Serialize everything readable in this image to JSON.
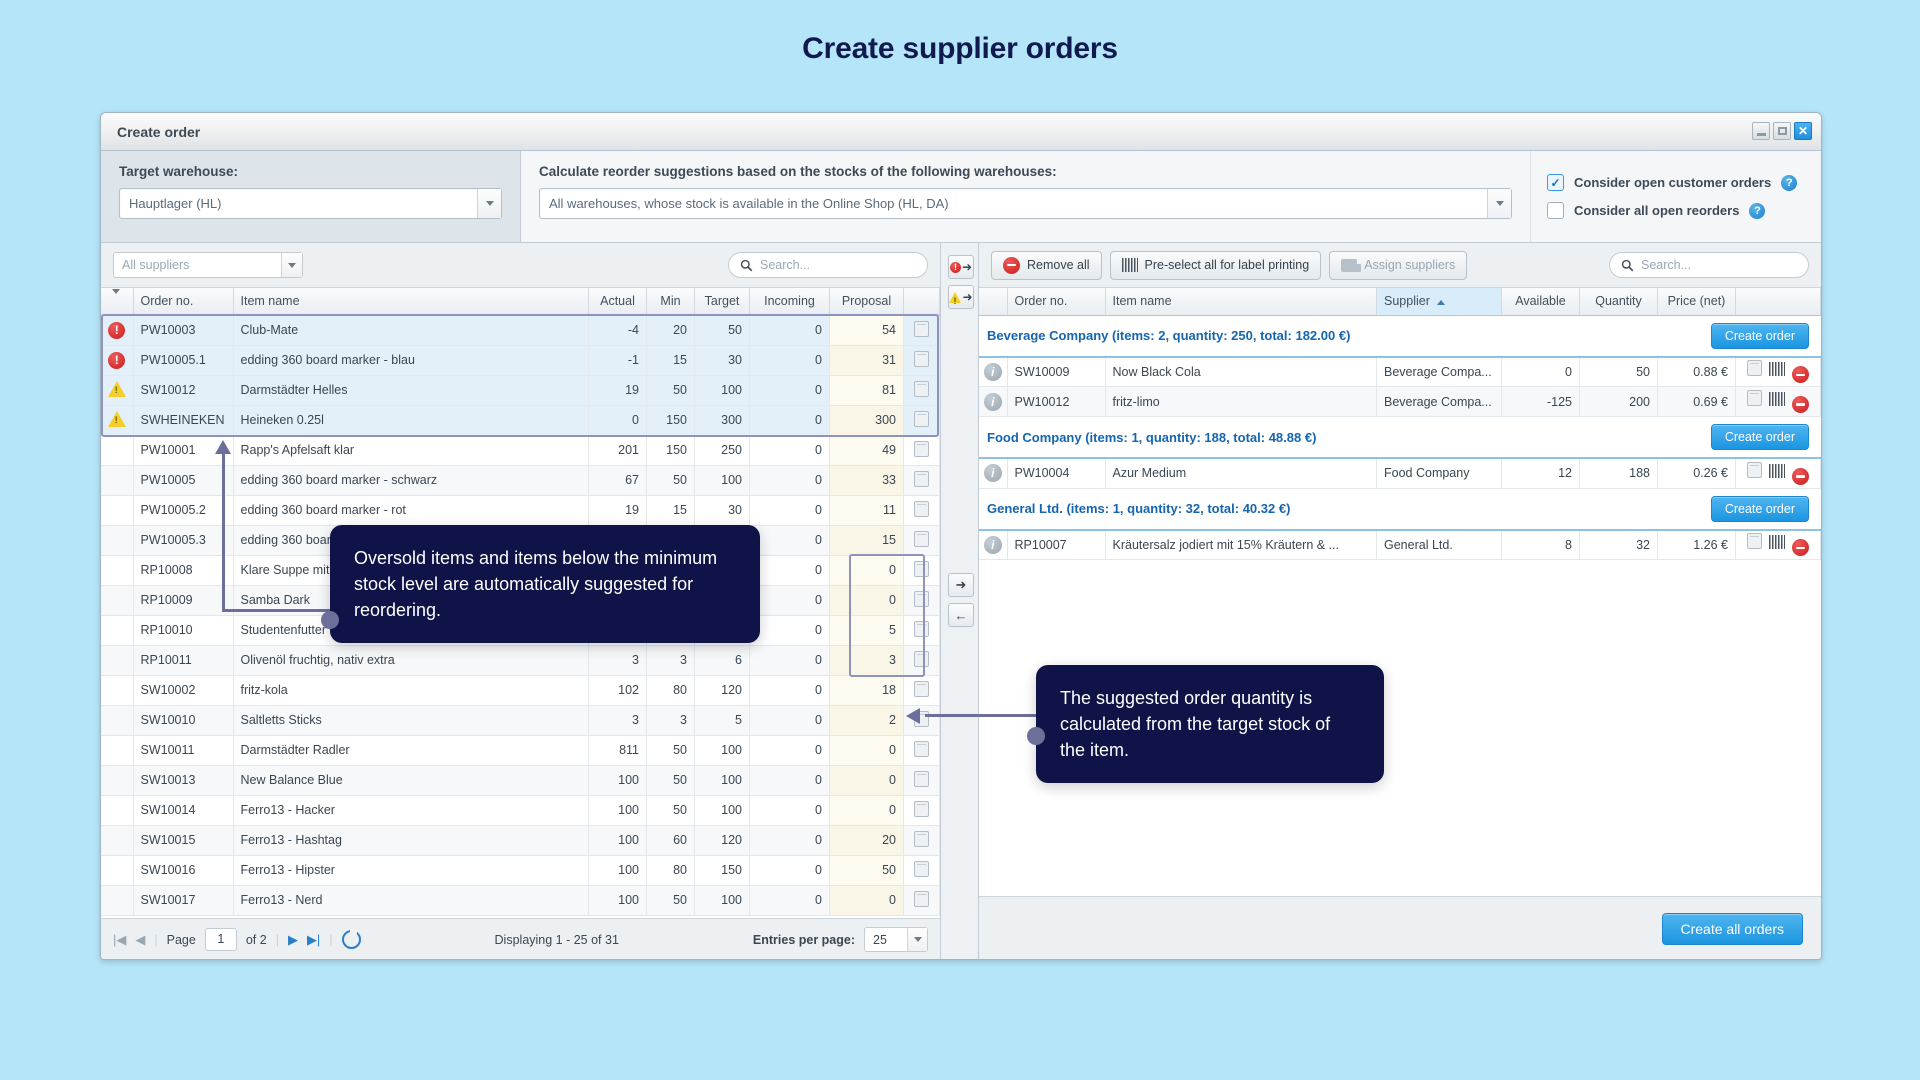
{
  "page_title": "Create supplier orders",
  "window": {
    "title": "Create order",
    "controls": {
      "minimize": "–",
      "maximize": "□",
      "close": "✕"
    }
  },
  "header": {
    "target_warehouse_label": "Target warehouse:",
    "target_warehouse_value": "Hauptlager (HL)",
    "reorder_label": "Calculate reorder suggestions based on the stocks of the following warehouses:",
    "reorder_value": "All warehouses, whose stock is available in the Online Shop (HL, DA)",
    "checkbox_open_customer_orders": "Consider open customer orders",
    "checkbox_open_reorders": "Consider all open reorders",
    "help_glyph": "?",
    "check_glyph": "✓"
  },
  "left_panel": {
    "supplier_filter_value": "All suppliers",
    "search_placeholder": "Search...",
    "columns": [
      "",
      "Order no.",
      "Item name",
      "Actual",
      "Min",
      "Target",
      "Incoming",
      "Proposal",
      ""
    ],
    "rows": [
      {
        "status": "error",
        "order_no": "PW10003",
        "item": "Club-Mate",
        "actual": "-4",
        "min": "20",
        "target": "50",
        "incoming": "0",
        "proposal": "54",
        "selected": true
      },
      {
        "status": "error",
        "order_no": "PW10005.1",
        "item": "edding 360 board marker - blau",
        "actual": "-1",
        "min": "15",
        "target": "30",
        "incoming": "0",
        "proposal": "31",
        "selected": true
      },
      {
        "status": "warning",
        "order_no": "SW10012",
        "item": "Darmstädter Helles",
        "actual": "19",
        "min": "50",
        "target": "100",
        "incoming": "0",
        "proposal": "81",
        "selected": true
      },
      {
        "status": "warning",
        "order_no": "SWHEINEKEN",
        "item": "Heineken 0.25l",
        "actual": "0",
        "min": "150",
        "target": "300",
        "incoming": "0",
        "proposal": "300",
        "selected": true
      },
      {
        "status": "",
        "order_no": "PW10001",
        "item": "Rapp's Apfelsaft klar",
        "actual": "201",
        "min": "150",
        "target": "250",
        "incoming": "0",
        "proposal": "49",
        "selected": false
      },
      {
        "status": "",
        "order_no": "PW10005",
        "item": "edding 360 board marker - schwarz",
        "actual": "67",
        "min": "50",
        "target": "100",
        "incoming": "0",
        "proposal": "33",
        "selected": false
      },
      {
        "status": "",
        "order_no": "PW10005.2",
        "item": "edding 360 board marker - rot",
        "actual": "19",
        "min": "15",
        "target": "30",
        "incoming": "0",
        "proposal": "11",
        "selected": false
      },
      {
        "status": "",
        "order_no": "PW10005.3",
        "item": "edding 360 board marker - grün",
        "actual": "",
        "min": "",
        "target": "",
        "incoming": "0",
        "proposal": "15",
        "selected": false
      },
      {
        "status": "",
        "order_no": "RP10008",
        "item": "Klare Suppe mit Einlage",
        "actual": "",
        "min": "",
        "target": "",
        "incoming": "0",
        "proposal": "0",
        "selected": false
      },
      {
        "status": "",
        "order_no": "RP10009",
        "item": "Samba Dark",
        "actual": "",
        "min": "",
        "target": "",
        "incoming": "0",
        "proposal": "0",
        "selected": false
      },
      {
        "status": "",
        "order_no": "RP10010",
        "item": "Studentenfutter natur",
        "actual": "",
        "min": "",
        "target": "",
        "incoming": "0",
        "proposal": "5",
        "selected": false
      },
      {
        "status": "",
        "order_no": "RP10011",
        "item": "Olivenöl fruchtig, nativ extra",
        "actual": "3",
        "min": "3",
        "target": "6",
        "incoming": "0",
        "proposal": "3",
        "selected": false
      },
      {
        "status": "",
        "order_no": "SW10002",
        "item": "fritz-kola",
        "actual": "102",
        "min": "80",
        "target": "120",
        "incoming": "0",
        "proposal": "18",
        "selected": false
      },
      {
        "status": "",
        "order_no": "SW10010",
        "item": "Saltletts Sticks",
        "actual": "3",
        "min": "3",
        "target": "5",
        "incoming": "0",
        "proposal": "2",
        "selected": false
      },
      {
        "status": "",
        "order_no": "SW10011",
        "item": "Darmstädter Radler",
        "actual": "811",
        "min": "50",
        "target": "100",
        "incoming": "0",
        "proposal": "0",
        "selected": false
      },
      {
        "status": "",
        "order_no": "SW10013",
        "item": "New Balance Blue",
        "actual": "100",
        "min": "50",
        "target": "100",
        "incoming": "0",
        "proposal": "0",
        "selected": false
      },
      {
        "status": "",
        "order_no": "SW10014",
        "item": "Ferro13 - Hacker",
        "actual": "100",
        "min": "50",
        "target": "100",
        "incoming": "0",
        "proposal": "0",
        "selected": false
      },
      {
        "status": "",
        "order_no": "SW10015",
        "item": "Ferro13 - Hashtag",
        "actual": "100",
        "min": "60",
        "target": "120",
        "incoming": "0",
        "proposal": "20",
        "selected": false
      },
      {
        "status": "",
        "order_no": "SW10016",
        "item": "Ferro13 - Hipster",
        "actual": "100",
        "min": "80",
        "target": "150",
        "incoming": "0",
        "proposal": "50",
        "selected": false
      },
      {
        "status": "",
        "order_no": "SW10017",
        "item": "Ferro13 - Nerd",
        "actual": "100",
        "min": "50",
        "target": "100",
        "incoming": "0",
        "proposal": "0",
        "selected": false
      }
    ],
    "pager": {
      "first": "|◀",
      "prev": "◀",
      "page_label": "Page",
      "page_value": "1",
      "of_label": "of 2",
      "next": "▶",
      "last": "▶|",
      "displaying": "Displaying 1 - 25 of 31",
      "entries_label": "Entries per page:",
      "entries_value": "25"
    }
  },
  "mid_column": {
    "move_errors": "→",
    "move_warnings": "→",
    "move_right": "➜",
    "move_left": "←"
  },
  "right_panel": {
    "toolbar": {
      "remove_all": "Remove all",
      "preselect_labels": "Pre-select all for label printing",
      "assign_suppliers": "Assign suppliers",
      "search_placeholder": "Search..."
    },
    "columns": [
      "",
      "Order no.",
      "Item name",
      "Supplier",
      "Available",
      "Quantity",
      "Price (net)",
      ""
    ],
    "sorted_column": "Supplier",
    "groups": [
      {
        "title": "Beverage Company (items: 2, quantity: 250, total: 182.00 €)",
        "create_button": "Create order",
        "rows": [
          {
            "order_no": "SW10009",
            "item": "Now Black Cola",
            "supplier": "Beverage Compa...",
            "available": "0",
            "quantity": "50",
            "price": "0.88 €"
          },
          {
            "order_no": "PW10012",
            "item": "fritz-limo",
            "supplier": "Beverage Compa...",
            "available": "-125",
            "quantity": "200",
            "price": "0.69 €"
          }
        ]
      },
      {
        "title": "Food Company (items: 1, quantity: 188, total: 48.88 €)",
        "create_button": "Create order",
        "rows": [
          {
            "order_no": "PW10004",
            "item": "Azur Medium",
            "supplier": "Food Company",
            "available": "12",
            "quantity": "188",
            "price": "0.26 €"
          }
        ]
      },
      {
        "title": "General Ltd. (items: 1, quantity: 32, total: 40.32 €)",
        "create_button": "Create order",
        "rows": [
          {
            "order_no": "RP10007",
            "item": "Kräutersalz jodiert mit 15% Kräutern & ...",
            "supplier": "General Ltd.",
            "available": "8",
            "quantity": "32",
            "price": "1.26 €"
          }
        ]
      }
    ],
    "footer_button": "Create all orders"
  },
  "callouts": [
    {
      "text": "Oversold items and items below the minimum stock level are automatically suggested for reordering."
    },
    {
      "text": "The suggested order quantity is calculated from the target stock of the item."
    }
  ],
  "colors": {
    "page_bg": "#b5e5f8",
    "title": "#111a4e",
    "accent_blue": "#1b95e0",
    "callout_bg": "#0f1347",
    "error_red": "#c91c1c",
    "warning_yellow": "#f4cf2a",
    "group_title": "#1565b0"
  }
}
